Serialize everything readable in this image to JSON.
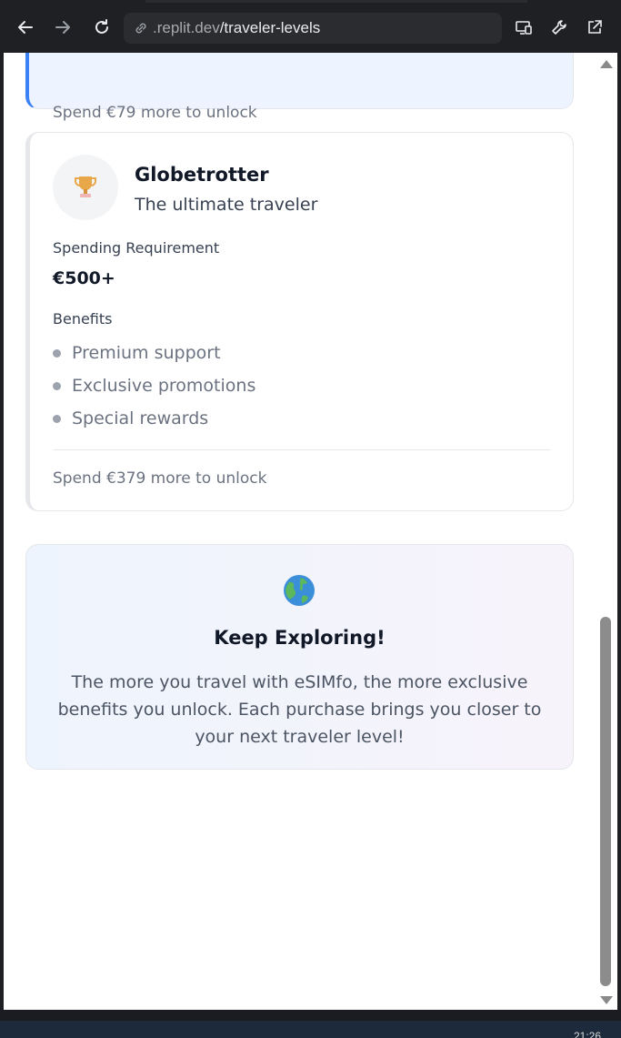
{
  "browser": {
    "url_prefix": ".replit.dev",
    "url_path": "/traveler-levels",
    "clock": "21:26"
  },
  "previous_card": {
    "unlock_text": "Spend €79 more to unlock"
  },
  "level_card": {
    "badge_icon": "trophy-icon",
    "title": "Globetrotter",
    "subtitle": "The ultimate traveler",
    "requirement_label": "Spending Requirement",
    "requirement_value": "€500+",
    "benefits_label": "Benefits",
    "benefits": [
      "Premium support",
      "Exclusive promotions",
      "Special rewards"
    ],
    "unlock_text": "Spend €379 more to unlock"
  },
  "explore": {
    "icon": "globe-icon",
    "title": "Keep Exploring!",
    "text": "The more you travel with eSIMfo, the more exclusive benefits you unlock. Each purchase brings you closer to your next traveler level!"
  }
}
